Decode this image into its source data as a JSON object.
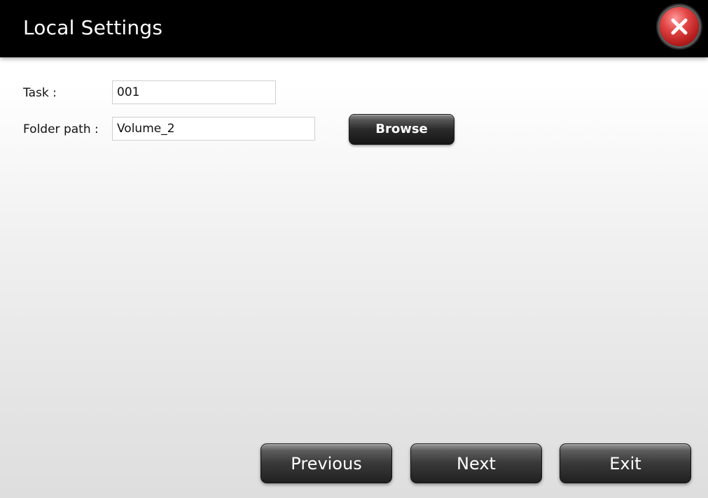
{
  "window": {
    "title": "Local Settings",
    "close_icon": "close-icon"
  },
  "form": {
    "task_label": "Task :",
    "task_value": "001",
    "folder_label": "Folder path :",
    "folder_value": "Volume_2",
    "browse_label": "Browse"
  },
  "nav": {
    "previous_label": "Previous",
    "next_label": "Next",
    "exit_label": "Exit"
  },
  "colors": {
    "titlebar": "#000000",
    "close_button": "#c62828",
    "button_dark": "#2b2b2b"
  }
}
